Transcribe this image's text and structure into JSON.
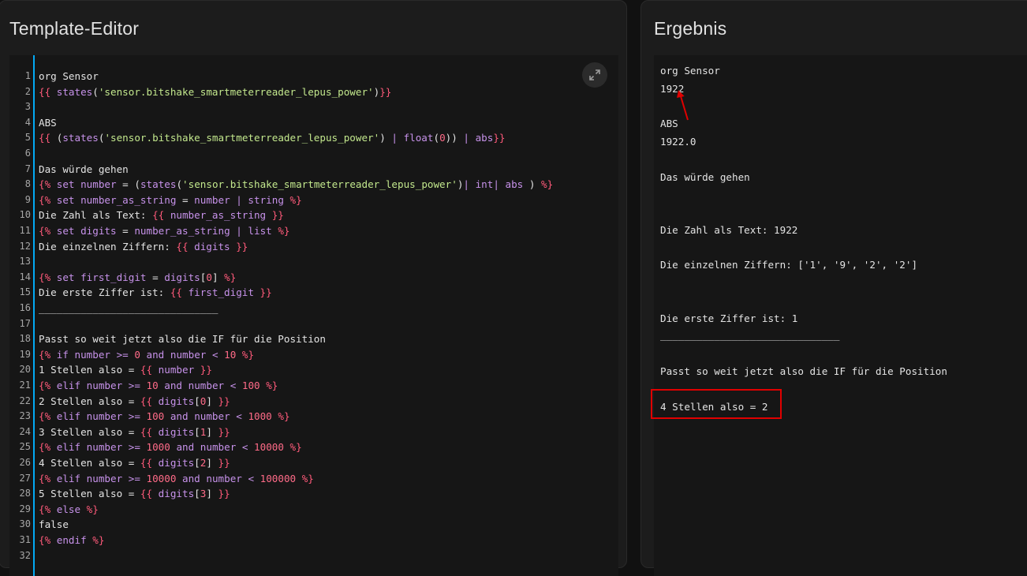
{
  "editor": {
    "title": "Template-Editor",
    "expand_icon": "expand-icon",
    "line_numbers": [
      "1",
      "2",
      "3",
      "4",
      "5",
      "6",
      "7",
      "8",
      "9",
      "10",
      "11",
      "12",
      "13",
      "14",
      "15",
      "16",
      "17",
      "18",
      "19",
      "20",
      "21",
      "22",
      "23",
      "24",
      "25",
      "26",
      "27",
      "28",
      "29",
      "30",
      "31",
      "32"
    ],
    "lines": [
      [
        [
          "t",
          "org Sensor"
        ]
      ],
      [
        [
          "d",
          "{{ "
        ],
        [
          "v",
          "states"
        ],
        [
          "t",
          "("
        ],
        [
          "s",
          "'sensor.bitshake_smartmeterreader_lepus_power'"
        ],
        [
          "t",
          ")"
        ],
        [
          "d",
          "}}"
        ]
      ],
      [],
      [
        [
          "t",
          "ABS"
        ]
      ],
      [
        [
          "d",
          "{{ "
        ],
        [
          "t",
          "("
        ],
        [
          "v",
          "states"
        ],
        [
          "t",
          "("
        ],
        [
          "s",
          "'sensor.bitshake_smartmeterreader_lepus_power'"
        ],
        [
          "t",
          ") "
        ],
        [
          "p",
          "| "
        ],
        [
          "v",
          "float"
        ],
        [
          "t",
          "("
        ],
        [
          "n",
          "0"
        ],
        [
          "t",
          ")) "
        ],
        [
          "p",
          "| "
        ],
        [
          "v",
          "abs"
        ],
        [
          "d",
          "}}"
        ]
      ],
      [],
      [
        [
          "t",
          "Das würde gehen"
        ]
      ],
      [
        [
          "d",
          "{% "
        ],
        [
          "v",
          "set "
        ],
        [
          "v",
          "number"
        ],
        [
          "t",
          " = ("
        ],
        [
          "v",
          "states"
        ],
        [
          "t",
          "("
        ],
        [
          "s",
          "'sensor.bitshake_smartmeterreader_lepus_power'"
        ],
        [
          "t",
          ")"
        ],
        [
          "p",
          "| "
        ],
        [
          "v",
          "int"
        ],
        [
          "p",
          "| "
        ],
        [
          "v",
          "abs"
        ],
        [
          "t",
          " ) "
        ],
        [
          "d",
          "%}"
        ]
      ],
      [
        [
          "d",
          "{% "
        ],
        [
          "v",
          "set "
        ],
        [
          "v",
          "number_as_string"
        ],
        [
          "t",
          " = "
        ],
        [
          "v",
          "number"
        ],
        [
          "p",
          " | "
        ],
        [
          "v",
          "string"
        ],
        [
          "d",
          " %}"
        ]
      ],
      [
        [
          "t",
          "Die Zahl als Text: "
        ],
        [
          "d",
          "{{ "
        ],
        [
          "v",
          "number_as_string"
        ],
        [
          "d",
          " }}"
        ]
      ],
      [
        [
          "d",
          "{% "
        ],
        [
          "v",
          "set "
        ],
        [
          "v",
          "digits"
        ],
        [
          "t",
          " = "
        ],
        [
          "v",
          "number_as_string"
        ],
        [
          "p",
          " | "
        ],
        [
          "v",
          "list"
        ],
        [
          "d",
          " %}"
        ]
      ],
      [
        [
          "t",
          "Die einzelnen Ziffern: "
        ],
        [
          "d",
          "{{ "
        ],
        [
          "v",
          "digits"
        ],
        [
          "d",
          " }}"
        ]
      ],
      [],
      [
        [
          "d",
          "{% "
        ],
        [
          "v",
          "set "
        ],
        [
          "v",
          "first_digit"
        ],
        [
          "t",
          " = "
        ],
        [
          "v",
          "digits"
        ],
        [
          "t",
          "["
        ],
        [
          "n",
          "0"
        ],
        [
          "t",
          "] "
        ],
        [
          "d",
          "%}"
        ]
      ],
      [
        [
          "t",
          "Die erste Ziffer ist: "
        ],
        [
          "d",
          "{{ "
        ],
        [
          "v",
          "first_digit"
        ],
        [
          "d",
          " }}"
        ]
      ],
      [
        [
          "t",
          "______________________________"
        ]
      ],
      [],
      [
        [
          "t",
          "Passt so weit jetzt also die IF für die Position"
        ]
      ],
      [
        [
          "d",
          "{% "
        ],
        [
          "v",
          "if "
        ],
        [
          "v",
          "number"
        ],
        [
          "p",
          " >= "
        ],
        [
          "n",
          "0"
        ],
        [
          "v",
          " and "
        ],
        [
          "v",
          "number"
        ],
        [
          "p",
          " < "
        ],
        [
          "n",
          "10"
        ],
        [
          "d",
          " %}"
        ]
      ],
      [
        [
          "t",
          "1 Stellen also = "
        ],
        [
          "d",
          "{{ "
        ],
        [
          "v",
          "number"
        ],
        [
          "d",
          " }}"
        ]
      ],
      [
        [
          "d",
          "{% "
        ],
        [
          "v",
          "elif "
        ],
        [
          "v",
          "number"
        ],
        [
          "p",
          " >= "
        ],
        [
          "n",
          "10"
        ],
        [
          "v",
          " and "
        ],
        [
          "v",
          "number"
        ],
        [
          "p",
          " < "
        ],
        [
          "n",
          "100"
        ],
        [
          "d",
          " %}"
        ]
      ],
      [
        [
          "t",
          "2 Stellen also = "
        ],
        [
          "d",
          "{{ "
        ],
        [
          "v",
          "digits"
        ],
        [
          "t",
          "["
        ],
        [
          "n",
          "0"
        ],
        [
          "t",
          "]"
        ],
        [
          "d",
          " }}"
        ]
      ],
      [
        [
          "d",
          "{% "
        ],
        [
          "v",
          "elif "
        ],
        [
          "v",
          "number"
        ],
        [
          "p",
          " >= "
        ],
        [
          "n",
          "100"
        ],
        [
          "v",
          " and "
        ],
        [
          "v",
          "number"
        ],
        [
          "p",
          " < "
        ],
        [
          "n",
          "1000"
        ],
        [
          "d",
          " %}"
        ]
      ],
      [
        [
          "t",
          "3 Stellen also = "
        ],
        [
          "d",
          "{{ "
        ],
        [
          "v",
          "digits"
        ],
        [
          "t",
          "["
        ],
        [
          "n",
          "1"
        ],
        [
          "t",
          "]"
        ],
        [
          "d",
          " }}"
        ]
      ],
      [
        [
          "d",
          "{% "
        ],
        [
          "v",
          "elif "
        ],
        [
          "v",
          "number"
        ],
        [
          "p",
          " >= "
        ],
        [
          "n",
          "1000"
        ],
        [
          "v",
          " and "
        ],
        [
          "v",
          "number"
        ],
        [
          "p",
          " < "
        ],
        [
          "n",
          "10000"
        ],
        [
          "d",
          " %}"
        ]
      ],
      [
        [
          "t",
          "4 Stellen also = "
        ],
        [
          "d",
          "{{ "
        ],
        [
          "v",
          "digits"
        ],
        [
          "t",
          "["
        ],
        [
          "n",
          "2"
        ],
        [
          "t",
          "]"
        ],
        [
          "d",
          " }}"
        ]
      ],
      [
        [
          "d",
          "{% "
        ],
        [
          "v",
          "elif "
        ],
        [
          "v",
          "number"
        ],
        [
          "p",
          " >= "
        ],
        [
          "n",
          "10000"
        ],
        [
          "v",
          " and "
        ],
        [
          "v",
          "number"
        ],
        [
          "p",
          " < "
        ],
        [
          "n",
          "100000"
        ],
        [
          "d",
          " %}"
        ]
      ],
      [
        [
          "t",
          "5 Stellen also = "
        ],
        [
          "d",
          "{{ "
        ],
        [
          "v",
          "digits"
        ],
        [
          "t",
          "["
        ],
        [
          "n",
          "3"
        ],
        [
          "t",
          "]"
        ],
        [
          "d",
          " }}"
        ]
      ],
      [
        [
          "d",
          "{% "
        ],
        [
          "v",
          "else"
        ],
        [
          "d",
          " %}"
        ]
      ],
      [
        [
          "t",
          "false"
        ]
      ],
      [
        [
          "d",
          "{% "
        ],
        [
          "v",
          "endif"
        ],
        [
          "d",
          " %}"
        ]
      ],
      []
    ]
  },
  "result": {
    "title": "Ergebnis",
    "lines": [
      "org Sensor",
      "1922",
      "ABS",
      "1922.0",
      "Das würde gehen",
      "Die Zahl als Text: 1922",
      "Die einzelnen Ziffern: ['1', '9', '2', '2']",
      "Die erste Ziffer ist: 1",
      "______________________________",
      "Passt so weit jetzt also die IF für die Position",
      "4 Stellen also = 2"
    ]
  },
  "colors": {
    "accent": "#03a9f4",
    "highlight": "#e00000"
  }
}
